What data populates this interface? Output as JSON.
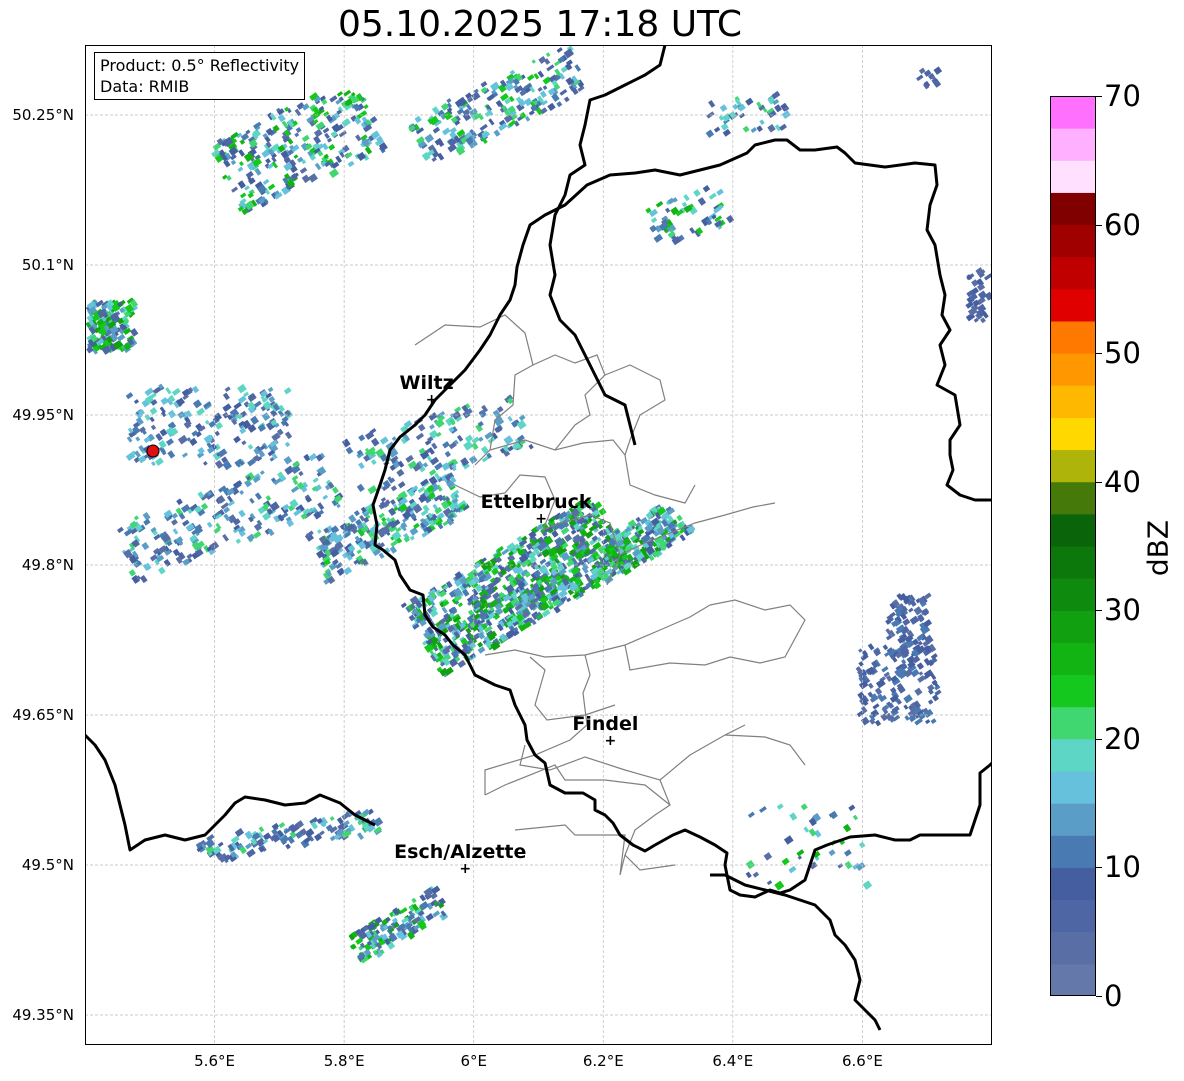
{
  "title": "05.10.2025 17:18 UTC",
  "info": {
    "product": "Product: 0.5° Reflectivity",
    "data": "Data: RMIB"
  },
  "map": {
    "lon_min": 5.4,
    "lon_max": 6.8,
    "lat_min": 49.32,
    "lat_max": 50.32,
    "lat_ticks": [
      "50.25°N",
      "50.1°N",
      "49.95°N",
      "49.8°N",
      "49.65°N",
      "49.5°N",
      "49.35°N"
    ],
    "lon_ticks": [
      "5.6°E",
      "5.8°E",
      "6°E",
      "6.2°E",
      "6.4°E",
      "6.6°E"
    ],
    "radar_site": {
      "lon": 5.505,
      "lat": 49.914
    },
    "cities": [
      {
        "name": "Wiltz",
        "lon": 5.935,
        "lat": 49.966
      },
      {
        "name": "Ettelbruck",
        "lon": 6.104,
        "lat": 49.847
      },
      {
        "name": "Findel",
        "lon": 6.211,
        "lat": 49.625
      },
      {
        "name": "Esch/Alzette",
        "lon": 5.987,
        "lat": 49.497
      }
    ]
  },
  "colorbar": {
    "label": "dBZ",
    "ticks": [
      "0",
      "10",
      "20",
      "30",
      "40",
      "50",
      "60",
      "70"
    ],
    "min": 0,
    "max": 70,
    "step": 2.5,
    "colors": [
      "#6478aa",
      "#5a6ea6",
      "#4e66a4",
      "#445ea0",
      "#4a7ab2",
      "#5a9ec8",
      "#66c2dc",
      "#5ed6c6",
      "#40d670",
      "#14c81e",
      "#12b414",
      "#10a010",
      "#0e8a0e",
      "#0c780c",
      "#0a640a",
      "#457a0a",
      "#afb40a",
      "#ffd800",
      "#ffb800",
      "#ff9800",
      "#ff7800",
      "#e00000",
      "#c00000",
      "#a00000",
      "#800000",
      "#ffe0ff",
      "#ffb0ff",
      "#ff70ff",
      "#e838e8"
    ]
  }
}
